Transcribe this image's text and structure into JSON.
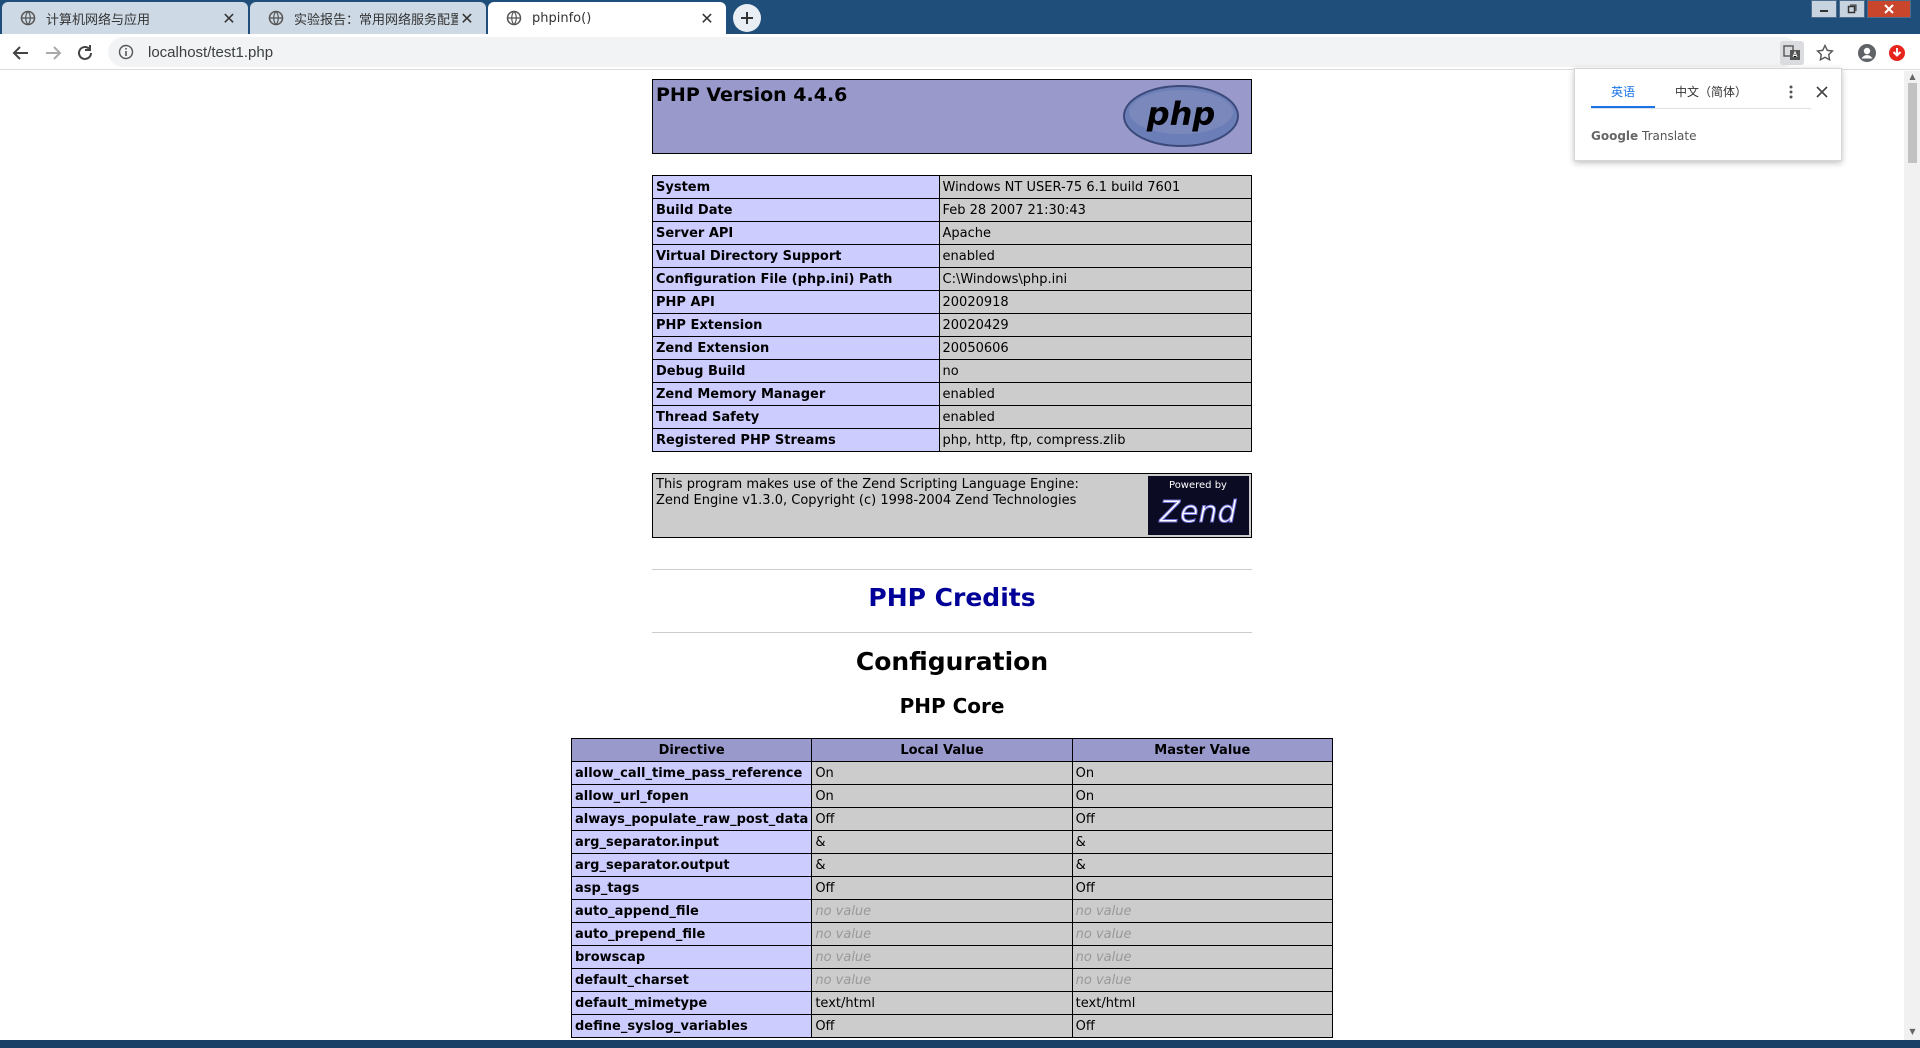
{
  "browser": {
    "tabs": [
      {
        "title": "计算机网络与应用",
        "active": false
      },
      {
        "title": "实验报告：常用网络服务配置-目",
        "active": false
      },
      {
        "title": "phpinfo()",
        "active": true
      }
    ],
    "url": "localhost/test1.php"
  },
  "translate_popup": {
    "source_lang": "英语",
    "target_lang": "中文（简体）",
    "footer_brand": "Google",
    "footer_text": "Translate"
  },
  "header": {
    "title": "PHP Version 4.4.6",
    "logo_text": "php"
  },
  "system_info": [
    {
      "label": "System",
      "value": "Windows NT USER-75 6.1 build 7601"
    },
    {
      "label": "Build Date",
      "value": "Feb 28 2007 21:30:43"
    },
    {
      "label": "Server API",
      "value": "Apache"
    },
    {
      "label": "Virtual Directory Support",
      "value": "enabled"
    },
    {
      "label": "Configuration File (php.ini) Path",
      "value": "C:\\Windows\\php.ini"
    },
    {
      "label": "PHP API",
      "value": "20020918"
    },
    {
      "label": "PHP Extension",
      "value": "20020429"
    },
    {
      "label": "Zend Extension",
      "value": "20050606"
    },
    {
      "label": "Debug Build",
      "value": "no"
    },
    {
      "label": "Zend Memory Manager",
      "value": "enabled"
    },
    {
      "label": "Thread Safety",
      "value": "enabled"
    },
    {
      "label": "Registered PHP Streams",
      "value": "php, http, ftp, compress.zlib"
    }
  ],
  "zend": {
    "line1": "This program makes use of the Zend Scripting Language Engine:",
    "line2": "Zend Engine v1.3.0, Copyright (c) 1998-2004 Zend Technologies",
    "logo_powered": "Powered by",
    "logo_text": "Zend"
  },
  "credits_link": "PHP Credits",
  "configuration_heading": "Configuration",
  "core_heading": "PHP Core",
  "core_table": {
    "headers": [
      "Directive",
      "Local Value",
      "Master Value"
    ],
    "rows": [
      {
        "directive": "allow_call_time_pass_reference",
        "local": "On",
        "master": "On",
        "novalue": false
      },
      {
        "directive": "allow_url_fopen",
        "local": "On",
        "master": "On",
        "novalue": false
      },
      {
        "directive": "always_populate_raw_post_data",
        "local": "Off",
        "master": "Off",
        "novalue": false
      },
      {
        "directive": "arg_separator.input",
        "local": "&",
        "master": "&",
        "novalue": false
      },
      {
        "directive": "arg_separator.output",
        "local": "&",
        "master": "&",
        "novalue": false
      },
      {
        "directive": "asp_tags",
        "local": "Off",
        "master": "Off",
        "novalue": false
      },
      {
        "directive": "auto_append_file",
        "local": "no value",
        "master": "no value",
        "novalue": true
      },
      {
        "directive": "auto_prepend_file",
        "local": "no value",
        "master": "no value",
        "novalue": true
      },
      {
        "directive": "browscap",
        "local": "no value",
        "master": "no value",
        "novalue": true
      },
      {
        "directive": "default_charset",
        "local": "no value",
        "master": "no value",
        "novalue": true
      },
      {
        "directive": "default_mimetype",
        "local": "text/html",
        "master": "text/html",
        "novalue": false
      },
      {
        "directive": "define_syslog_variables",
        "local": "Off",
        "master": "Off",
        "novalue": false
      }
    ]
  }
}
